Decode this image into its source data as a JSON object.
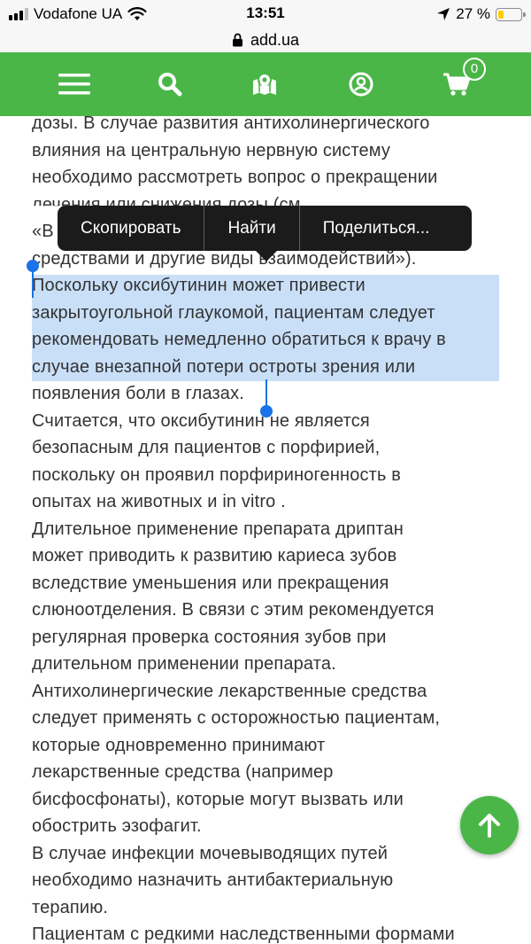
{
  "status_bar": {
    "carrier": "Vodafone UA",
    "time": "13:51",
    "battery_percent": "27 %",
    "battery_level": 0.27,
    "battery_color": "#ffcc00",
    "signal_bars_active": 3,
    "signal_bars_total": 4
  },
  "browser": {
    "domain": "add.ua"
  },
  "header": {
    "background": "#4bb648",
    "icons": [
      "menu-icon",
      "search-icon",
      "map-icon",
      "account-icon",
      "cart-icon"
    ],
    "cart_count": "0"
  },
  "article": {
    "lines": [
      "дозы. В случае развития антихолинергического",
      "влияния на центральную нервную систему",
      "необходимо рассмотреть вопрос о прекращении",
      "лечения или снижения дозы (см.",
      "«В",
      "средствами и другие виды взаимодействий»).",
      "Поскольку оксибутинин может привести",
      "закрытоугольной глаукомой, пациентам следует",
      "рекомендовать немедленно обратиться к врачу в",
      "случае внезапной потери остроты зрения или",
      "появления боли в глазах.",
      "Считается, что оксибутинин не является",
      "безопасным для пациентов с порфирией,",
      "поскольку он проявил порфириногенность в",
      "опытах на животных и in vitro .",
      "Длительное применение препарата дриптан",
      "может приводить к развитию кариеса зубов",
      "вследствие уменьшения или прекращения",
      "слюноотделения. В связи с этим рекомендуется",
      "регулярная проверка состояния зубов при",
      "длительном применении препарата.",
      "Антихолинергические лекарственные средства",
      "следует применять с осторожностью пациентам,",
      "которые одновременно принимают",
      "лекарственные средства (например",
      "бисфосфонаты), которые могут вызвать или",
      "обострить эзофагит.",
      "В случае инфекции мочевыводящих путей",
      "необходимо назначить антибактериальную",
      "терапию.",
      "Пациентам с редкими наследственными формами"
    ],
    "selection_color": "#c9dff8",
    "handle_color": "#1a73e8"
  },
  "context_menu": {
    "items": [
      "Скопировать",
      "Найти",
      "Поделиться..."
    ]
  },
  "fab": {
    "icon": "arrow-up-icon"
  }
}
